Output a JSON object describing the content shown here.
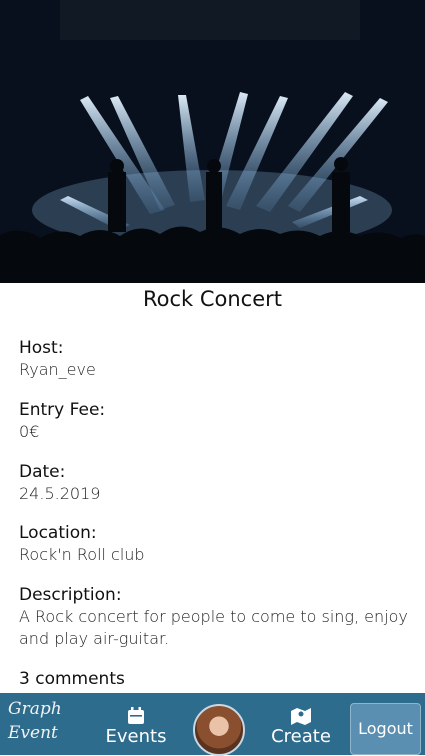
{
  "event": {
    "title": "Rock Concert",
    "details": [
      {
        "label": "Host:",
        "value": "Ryan_eve"
      },
      {
        "label": "Entry Fee:",
        "value": "0€"
      },
      {
        "label": "Date:",
        "value": "24.5.2019"
      },
      {
        "label": "Location:",
        "value": "Rock'n Roll club"
      },
      {
        "label": "Description:",
        "value": "A Rock concert for people to come to sing, enjoy and play air-guitar."
      }
    ],
    "comments": "3 comments"
  },
  "nav": {
    "logo_line1": "Graph",
    "logo_line2": "Event",
    "events_label": "Events",
    "create_label": "Create",
    "logout_label": "Logout"
  },
  "colors": {
    "navbar": "#2e6c8e",
    "logout_button": "#5b8fb1"
  }
}
